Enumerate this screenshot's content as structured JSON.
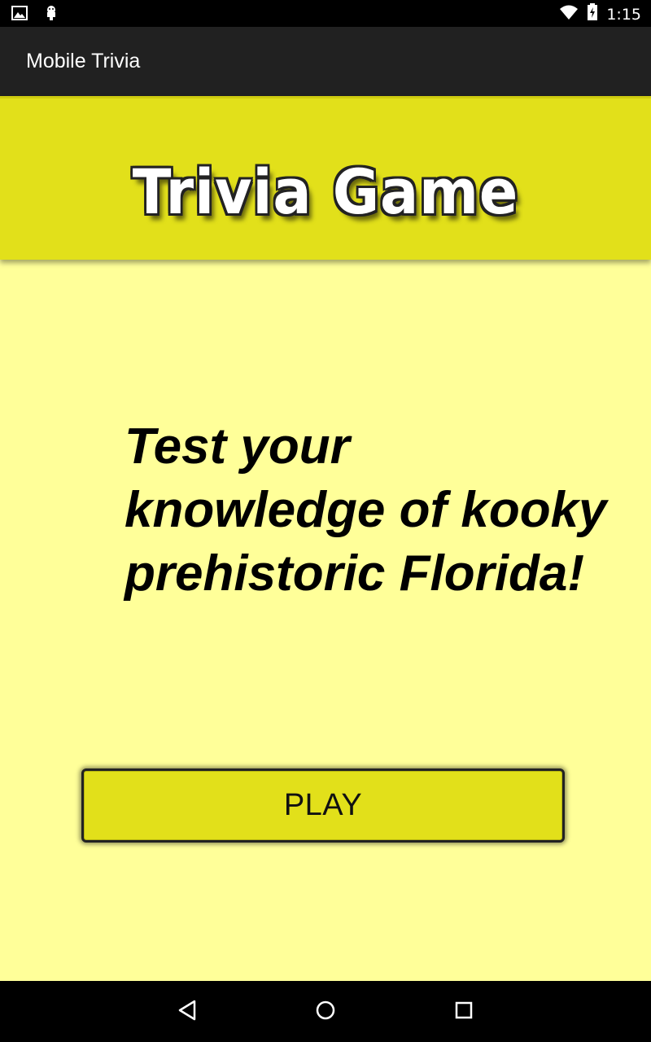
{
  "status_bar": {
    "time": "1:15",
    "left_icons": [
      "image-icon",
      "android-icon"
    ],
    "right_icons": [
      "wifi-icon",
      "battery-icon"
    ]
  },
  "action_bar": {
    "title": "Mobile Trivia"
  },
  "banner": {
    "logo_text": "Trivia Game"
  },
  "main": {
    "tagline": "Test your knowledge of kooky prehistoric Florida!",
    "play_button_label": "PLAY"
  },
  "nav_bar": {
    "buttons": [
      "back-icon",
      "home-icon",
      "recents-icon"
    ]
  },
  "colors": {
    "background": "#ffff99",
    "banner": "#e2e01a",
    "button": "#e2e01a",
    "action_bar": "#212121"
  }
}
